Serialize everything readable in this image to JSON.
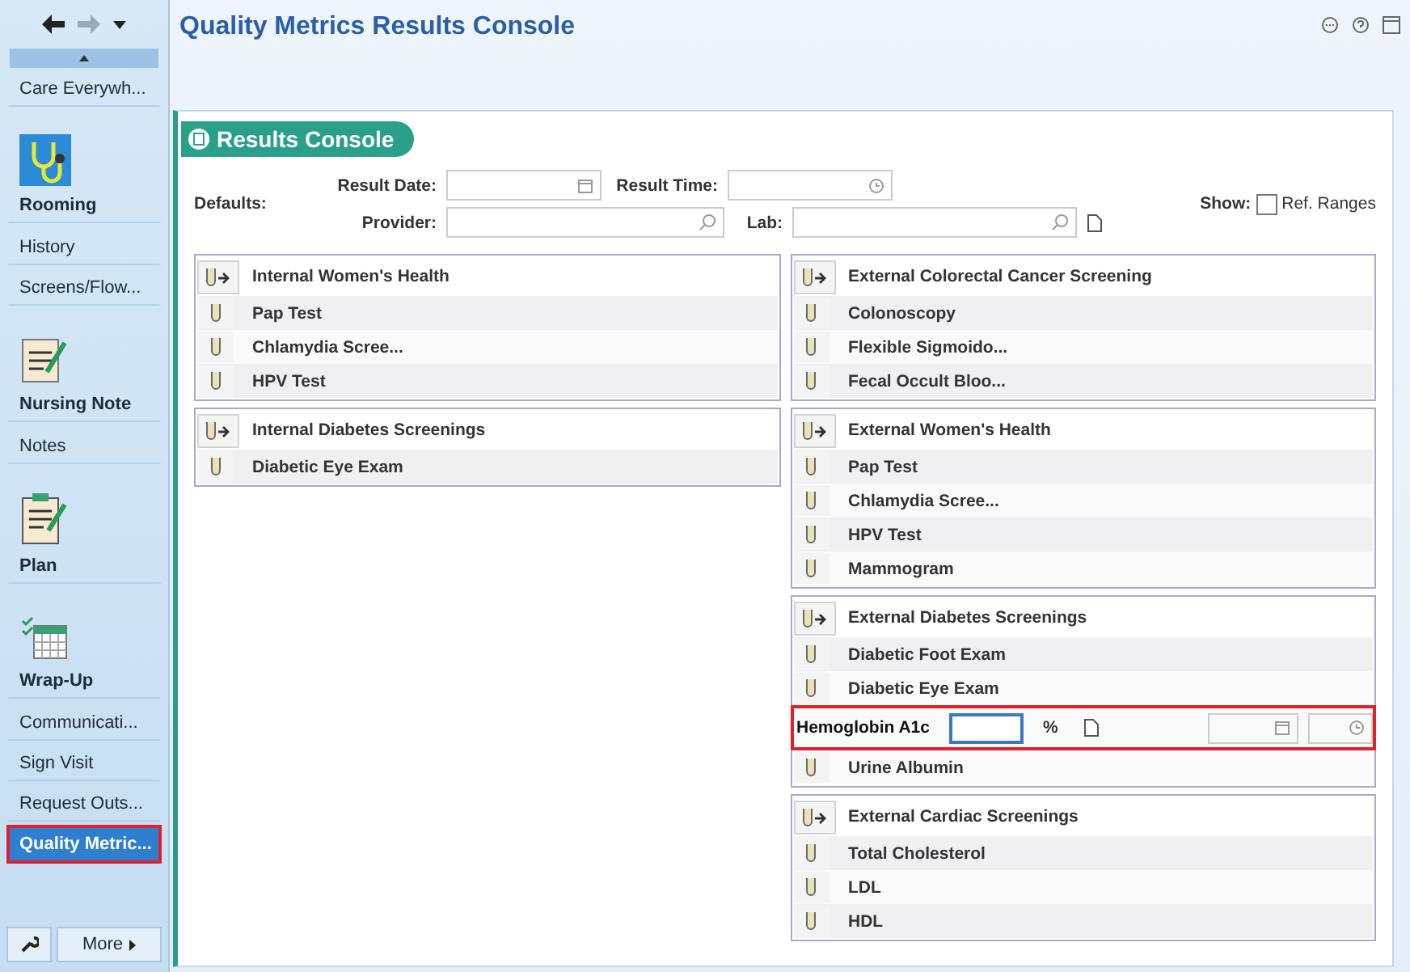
{
  "title": "Quality Metrics Results Console",
  "sidebar": {
    "items": [
      {
        "label": "Care Everywh...",
        "kind": "text",
        "selected": false
      },
      {
        "label": "Rooming",
        "kind": "icon",
        "selected": false
      },
      {
        "label": "History",
        "kind": "text",
        "selected": false
      },
      {
        "label": "Screens/Flow...",
        "kind": "text",
        "selected": false
      },
      {
        "label": "Nursing Note",
        "kind": "icon",
        "selected": false
      },
      {
        "label": "Notes",
        "kind": "text",
        "selected": false
      },
      {
        "label": "Plan",
        "kind": "icon",
        "selected": false
      },
      {
        "label": "Wrap-Up",
        "kind": "icon",
        "selected": false
      },
      {
        "label": "Communicati...",
        "kind": "text",
        "selected": false
      },
      {
        "label": "Sign Visit",
        "kind": "text",
        "selected": false
      },
      {
        "label": "Request Outs...",
        "kind": "text",
        "selected": false
      },
      {
        "label": "Quality Metric...",
        "kind": "text",
        "selected": true
      }
    ],
    "more": "More"
  },
  "console": {
    "tab": "Results Console",
    "defaults_label": "Defaults:",
    "result_date": "Result Date:",
    "result_time": "Result Time:",
    "provider": "Provider:",
    "lab": "Lab:",
    "show": {
      "label": "Show:",
      "option": "Ref. Ranges",
      "checked": false
    }
  },
  "columns": [
    [
      {
        "title": "Internal Women's Health",
        "items": [
          {
            "kind": "test",
            "label": "Pap Test"
          },
          {
            "kind": "test",
            "label": "Chlamydia Scree..."
          },
          {
            "kind": "test",
            "label": "HPV Test"
          }
        ]
      },
      {
        "title": "Internal Diabetes Screenings",
        "items": [
          {
            "kind": "test",
            "label": "Diabetic Eye Exam"
          }
        ]
      }
    ],
    [
      {
        "title": "External Colorectal Cancer Screening",
        "items": [
          {
            "kind": "test",
            "label": "Colonoscopy"
          },
          {
            "kind": "test",
            "label": "Flexible Sigmoido..."
          },
          {
            "kind": "test",
            "label": "Fecal Occult Bloo..."
          }
        ]
      },
      {
        "title": "External Women's Health",
        "items": [
          {
            "kind": "test",
            "label": "Pap Test"
          },
          {
            "kind": "test",
            "label": "Chlamydia Scree..."
          },
          {
            "kind": "test",
            "label": "HPV Test"
          },
          {
            "kind": "test",
            "label": "Mammogram"
          }
        ]
      },
      {
        "title": "External Diabetes Screenings",
        "items": [
          {
            "kind": "test",
            "label": "Diabetic Foot Exam"
          },
          {
            "kind": "test",
            "label": "Diabetic Eye Exam"
          },
          {
            "kind": "entry",
            "label": "Hemoglobin A1c",
            "unit": "%",
            "focused": true
          },
          {
            "kind": "test",
            "label": "Urine Albumin"
          }
        ]
      },
      {
        "title": "External Cardiac Screenings",
        "items": [
          {
            "kind": "test",
            "label": "Total Cholesterol"
          },
          {
            "kind": "test",
            "label": "LDL"
          },
          {
            "kind": "test",
            "label": "HDL"
          }
        ]
      }
    ]
  ]
}
